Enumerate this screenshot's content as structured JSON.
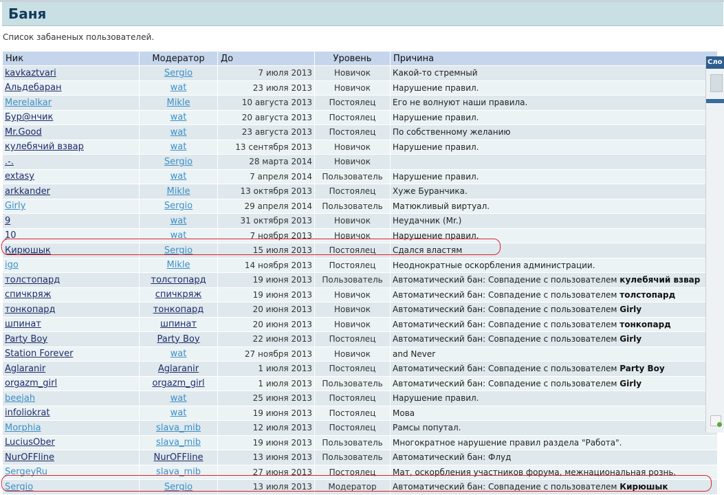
{
  "page": {
    "title": "Баня",
    "subtitle": "Список забаненых пользователей."
  },
  "table": {
    "headers": [
      "Ник",
      "Модератор",
      "До",
      "Уровень",
      "Причина"
    ],
    "rows": [
      {
        "nick": "kavkaztvari",
        "nick_style": "dark",
        "mod": "Sergio",
        "mod_style": "light",
        "date": "7 июля 2013",
        "level": "Новичок",
        "reason": "Какой-то стремный",
        "reason_bold": ""
      },
      {
        "nick": "Альдебаран",
        "nick_style": "dark",
        "mod": "wat",
        "mod_style": "light",
        "date": "23 июля 2013",
        "level": "Новичок",
        "reason": "Нарушение правил.",
        "reason_bold": ""
      },
      {
        "nick": "Merelalkar",
        "nick_style": "light",
        "mod": "Mikle",
        "mod_style": "light",
        "date": "10 августа 2013",
        "level": "Постоялец",
        "reason": "Его не волнуют наши правила.",
        "reason_bold": ""
      },
      {
        "nick": "Бур@нчик",
        "nick_style": "dark",
        "mod": "wat",
        "mod_style": "light",
        "date": "20 августа 2013",
        "level": "Постоялец",
        "reason": "Нарушение правил.",
        "reason_bold": ""
      },
      {
        "nick": "Mr.Good",
        "nick_style": "dark",
        "mod": "wat",
        "mod_style": "light",
        "date": "23 августа 2013",
        "level": "Постоялец",
        "reason": "По собственному желанию",
        "reason_bold": ""
      },
      {
        "nick": "кулебячий взвар",
        "nick_style": "dark",
        "mod": "wat",
        "mod_style": "light",
        "date": "13 сентября 2013",
        "level": "Новичок",
        "reason": "Нарушение правил.",
        "reason_bold": ""
      },
      {
        "nick": ".-.",
        "nick_style": "dark",
        "mod": "Sergio",
        "mod_style": "light",
        "date": "28 марта 2014",
        "level": "Новичок",
        "reason": "",
        "reason_bold": ""
      },
      {
        "nick": "extasy",
        "nick_style": "dark",
        "mod": "wat",
        "mod_style": "light",
        "date": "7 апреля 2014",
        "level": "Пользователь",
        "reason": "Нарушение правил.",
        "reason_bold": ""
      },
      {
        "nick": "arkkander",
        "nick_style": "dark",
        "mod": "Mikle",
        "mod_style": "light",
        "date": "13 октября 2013",
        "level": "Постоялец",
        "reason": "Хуже Буранчика.",
        "reason_bold": ""
      },
      {
        "nick": "Girly",
        "nick_style": "light",
        "mod": "Sergio",
        "mod_style": "light",
        "date": "29 апреля 2014",
        "level": "Пользователь",
        "reason": "Матюкливый виртуал.",
        "reason_bold": ""
      },
      {
        "nick": "9",
        "nick_style": "dark",
        "mod": "wat",
        "mod_style": "light",
        "date": "31 октября 2013",
        "level": "Новичок",
        "reason": "Неудачник (Mr.)",
        "reason_bold": ""
      },
      {
        "nick": "10",
        "nick_style": "dark",
        "mod": "wat",
        "mod_style": "light",
        "date": "7 ноября 2013",
        "level": "Новичок",
        "reason": "Нарушение правил.",
        "reason_bold": ""
      },
      {
        "nick": "Кирюшык",
        "nick_style": "dark",
        "mod": "Sergio",
        "mod_style": "light",
        "date": "15 июля 2013",
        "level": "Постоялец",
        "reason": "Сдался властям",
        "reason_bold": ""
      },
      {
        "nick": "igo",
        "nick_style": "light",
        "mod": "Mikle",
        "mod_style": "light",
        "date": "14 ноября 2013",
        "level": "Постоялец",
        "reason": "Неоднократные оскорбления администрации.",
        "reason_bold": ""
      },
      {
        "nick": "толстопард",
        "nick_style": "dark",
        "mod": "толстопард",
        "mod_style": "dark",
        "date": "19 июня 2013",
        "level": "Пользователь",
        "reason": "Автоматический бан: Совпадение с пользователем ",
        "reason_bold": "кулебячий взвар"
      },
      {
        "nick": "спичкряж",
        "nick_style": "dark",
        "mod": "спичкряж",
        "mod_style": "dark",
        "date": "19 июня 2013",
        "level": "Новичок",
        "reason": "Автоматический бан: Совпадение с пользователем ",
        "reason_bold": "толстопард"
      },
      {
        "nick": "тонкопард",
        "nick_style": "dark",
        "mod": "тонкопард",
        "mod_style": "dark",
        "date": "20 июня 2013",
        "level": "Новичок",
        "reason": "Автоматический бан: Совпадение с пользователем ",
        "reason_bold": "Girly"
      },
      {
        "nick": "шпинат",
        "nick_style": "dark",
        "mod": "шпинат",
        "mod_style": "dark",
        "date": "20 июня 2013",
        "level": "Новичок",
        "reason": "Автоматический бан: Совпадение с пользователем ",
        "reason_bold": "тонкопард"
      },
      {
        "nick": "Party Boy",
        "nick_style": "dark",
        "mod": "Party Boy",
        "mod_style": "dark",
        "date": "22 июня 2013",
        "level": "Постоялец",
        "reason": "Автоматический бан: Совпадение с пользователем ",
        "reason_bold": "Girly"
      },
      {
        "nick": "Station Forever",
        "nick_style": "dark",
        "mod": "wat",
        "mod_style": "light",
        "date": "27 ноября 2013",
        "level": "Новичок",
        "reason": "and Never",
        "reason_bold": ""
      },
      {
        "nick": "Aglaranir",
        "nick_style": "dark",
        "mod": "Aglaranir",
        "mod_style": "dark",
        "date": "1 июля 2013",
        "level": "Постоялец",
        "reason": "Автоматический бан: Совпадение с пользователем ",
        "reason_bold": "Party Boy"
      },
      {
        "nick": "orgazm_girl",
        "nick_style": "dark",
        "mod": "orgazm_girl",
        "mod_style": "dark",
        "date": "1 июля 2013",
        "level": "Пользователь",
        "reason": "Автоматический бан: Совпадение с пользователем ",
        "reason_bold": "Girly"
      },
      {
        "nick": "beejah",
        "nick_style": "light",
        "mod": "wat",
        "mod_style": "light",
        "date": "25 июня 2013",
        "level": "Постоялец",
        "reason": "Нарушение правил.",
        "reason_bold": ""
      },
      {
        "nick": "infoliokrat",
        "nick_style": "dark",
        "mod": "wat",
        "mod_style": "light",
        "date": "19 июня 2013",
        "level": "Постоялец",
        "reason": "Мова",
        "reason_bold": ""
      },
      {
        "nick": "Morphia",
        "nick_style": "light",
        "mod": "slava_mib",
        "mod_style": "light",
        "date": "12 июля 2013",
        "level": "Постоялец",
        "reason": "Рамсы попутал.",
        "reason_bold": ""
      },
      {
        "nick": "LuciusOber",
        "nick_style": "dark",
        "mod": "slava_mib",
        "mod_style": "light",
        "date": "19 июня 2013",
        "level": "Пользователь",
        "reason": "Многократное нарушение правил раздела \"Работа\".",
        "reason_bold": ""
      },
      {
        "nick": "NurOFFline",
        "nick_style": "dark",
        "mod": "NurOFFline",
        "mod_style": "dark",
        "date": "13 июня 2013",
        "level": "Пользователь",
        "reason": "Автоматический бан: Флуд",
        "reason_bold": ""
      },
      {
        "nick": "SergeyRu",
        "nick_style": "light",
        "mod": "slava_mib",
        "mod_style": "light",
        "date": "27 июня 2013",
        "level": "Постоялец",
        "reason": "Мат, оскорбления участников форума, межнациональная рознь.",
        "reason_bold": ""
      },
      {
        "nick": "Sergio",
        "nick_style": "light",
        "mod": "Sergio",
        "mod_style": "light",
        "date": "13 июля 2013",
        "level": "Модератор",
        "reason": "Автоматический бан: Совпадение с пользователем ",
        "reason_bold": "Кирюшык"
      }
    ]
  },
  "side_panel": {
    "header_text": "Сло",
    "thumb_icon": "list-thumbnail-icon",
    "add_icon": "add-note-icon"
  },
  "colors": {
    "title_bar": "#c9dfe4",
    "header_row": "#c5d6ec",
    "row_odd": "#dfe8ec",
    "row_even": "#ecf3f5",
    "link_dark": "#1d2b6b",
    "link_light": "#3a8fc9",
    "highlight": "#d9232e"
  }
}
